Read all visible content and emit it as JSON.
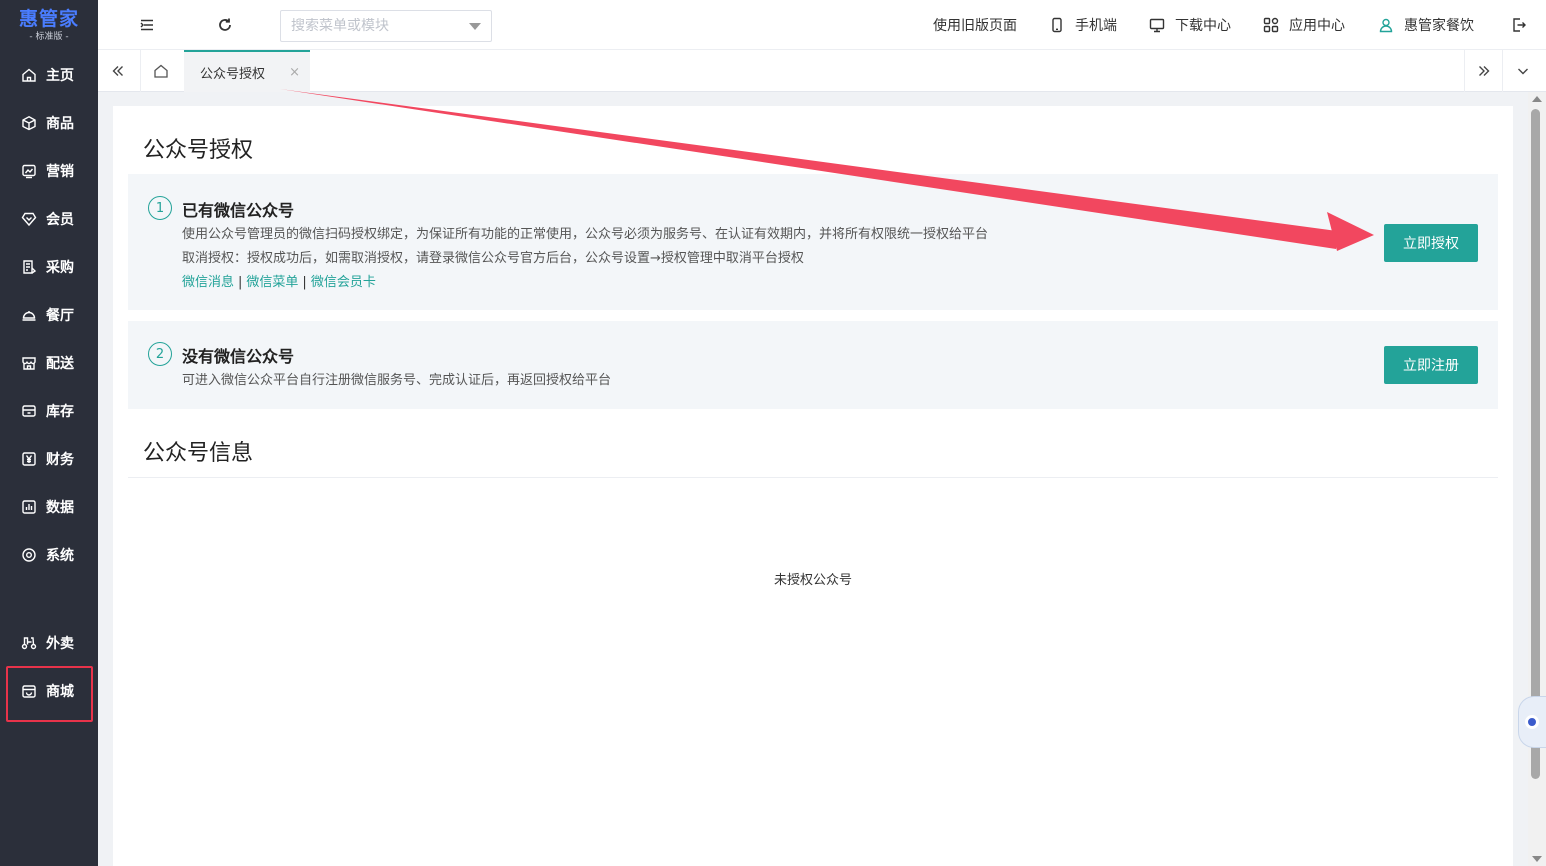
{
  "app": {
    "logo": "惠管家",
    "edition": "- 标准版 -"
  },
  "sidebar": {
    "items": [
      {
        "label": "主页",
        "icon": "home-icon"
      },
      {
        "label": "商品",
        "icon": "cube-icon"
      },
      {
        "label": "营销",
        "icon": "chart-icon"
      },
      {
        "label": "会员",
        "icon": "diamond-icon"
      },
      {
        "label": "采购",
        "icon": "purchase-icon"
      },
      {
        "label": "餐厅",
        "icon": "cloche-icon"
      },
      {
        "label": "配送",
        "icon": "store-icon"
      },
      {
        "label": "库存",
        "icon": "box-icon"
      },
      {
        "label": "财务",
        "icon": "yen-icon"
      },
      {
        "label": "数据",
        "icon": "bar-chart-icon"
      },
      {
        "label": "系统",
        "icon": "settings-icon"
      },
      {
        "label": "外卖",
        "icon": "scooter-icon"
      },
      {
        "label": "商城",
        "icon": "shop-icon"
      }
    ],
    "highlighted": "商城"
  },
  "topbar": {
    "search_placeholder": "搜索菜单或模块",
    "links": {
      "old_version": "使用旧版页面",
      "mobile": "手机端",
      "download": "下载中心",
      "apps": "应用中心",
      "user": "惠管家餐饮"
    }
  },
  "tabs": {
    "active_label": "公众号授权",
    "close": "×"
  },
  "page": {
    "title": "公众号授权",
    "cards": [
      {
        "num": "1",
        "title": "已有微信公众号",
        "lines": [
          "使用公众号管理员的微信扫码授权绑定，为保证所有功能的正常使用，公众号必须为服务号、在认证有效期内，并将所有权限统一授权给平台",
          "取消授权：授权成功后，如需取消授权，请登录微信公众号官方后台，公众号设置→授权管理中取消平台授权"
        ],
        "links": [
          "微信消息",
          "微信菜单",
          "微信会员卡"
        ],
        "button": "立即授权"
      },
      {
        "num": "2",
        "title": "没有微信公众号",
        "lines": [
          "可进入微信公众平台自行注册微信服务号、完成认证后，再返回授权给平台"
        ],
        "button": "立即注册"
      }
    ],
    "info_title": "公众号信息",
    "empty_text": "未授权公众号"
  },
  "colors": {
    "accent": "#23a399",
    "sidebar_bg": "#2b2f3a",
    "highlight": "#e8334a",
    "arrow": "#f2475f"
  }
}
